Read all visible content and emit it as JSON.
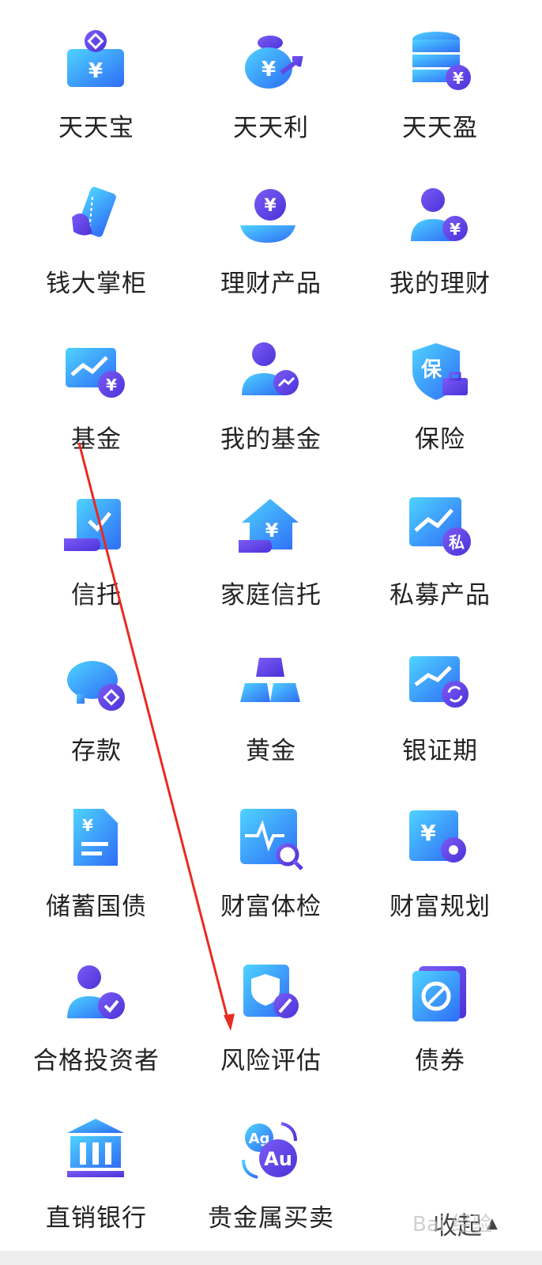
{
  "colors": {
    "blue_light": "#4fd3ff",
    "blue": "#2f7cf6",
    "purple": "#5a3fe0",
    "arrow": "#e82b22"
  },
  "items": [
    {
      "label": "天天宝",
      "icon": "wallet-coin-icon"
    },
    {
      "label": "天天利",
      "icon": "money-bag-icon"
    },
    {
      "label": "天天盈",
      "icon": "coin-stack-icon"
    },
    {
      "label": "钱大掌柜",
      "icon": "hand-card-icon"
    },
    {
      "label": "理财产品",
      "icon": "hand-coin-icon"
    },
    {
      "label": "我的理财",
      "icon": "user-coin-icon"
    },
    {
      "label": "基金",
      "icon": "trend-coin-icon"
    },
    {
      "label": "我的基金",
      "icon": "user-trend-icon"
    },
    {
      "label": "保险",
      "icon": "shield-bag-icon"
    },
    {
      "label": "信托",
      "icon": "hand-check-icon"
    },
    {
      "label": "家庭信托",
      "icon": "house-coin-icon"
    },
    {
      "label": "私募产品",
      "icon": "trend-private-icon"
    },
    {
      "label": "存款",
      "icon": "piggy-bank-icon"
    },
    {
      "label": "黄金",
      "icon": "gold-bars-icon"
    },
    {
      "label": "银证期",
      "icon": "trend-exchange-icon"
    },
    {
      "label": "储蓄国债",
      "icon": "bond-document-icon"
    },
    {
      "label": "财富体检",
      "icon": "pulse-search-icon"
    },
    {
      "label": "财富规划",
      "icon": "coin-gear-icon"
    },
    {
      "label": "合格投资者",
      "icon": "user-check-icon"
    },
    {
      "label": "风险评估",
      "icon": "shield-pen-icon"
    },
    {
      "label": "债券",
      "icon": "bond-card-icon"
    },
    {
      "label": "直销银行",
      "icon": "bank-icon"
    },
    {
      "label": "贵金属买卖",
      "icon": "ag-au-exchange-icon"
    }
  ],
  "collapse_label": "收起",
  "watermark": "Bai 经验"
}
